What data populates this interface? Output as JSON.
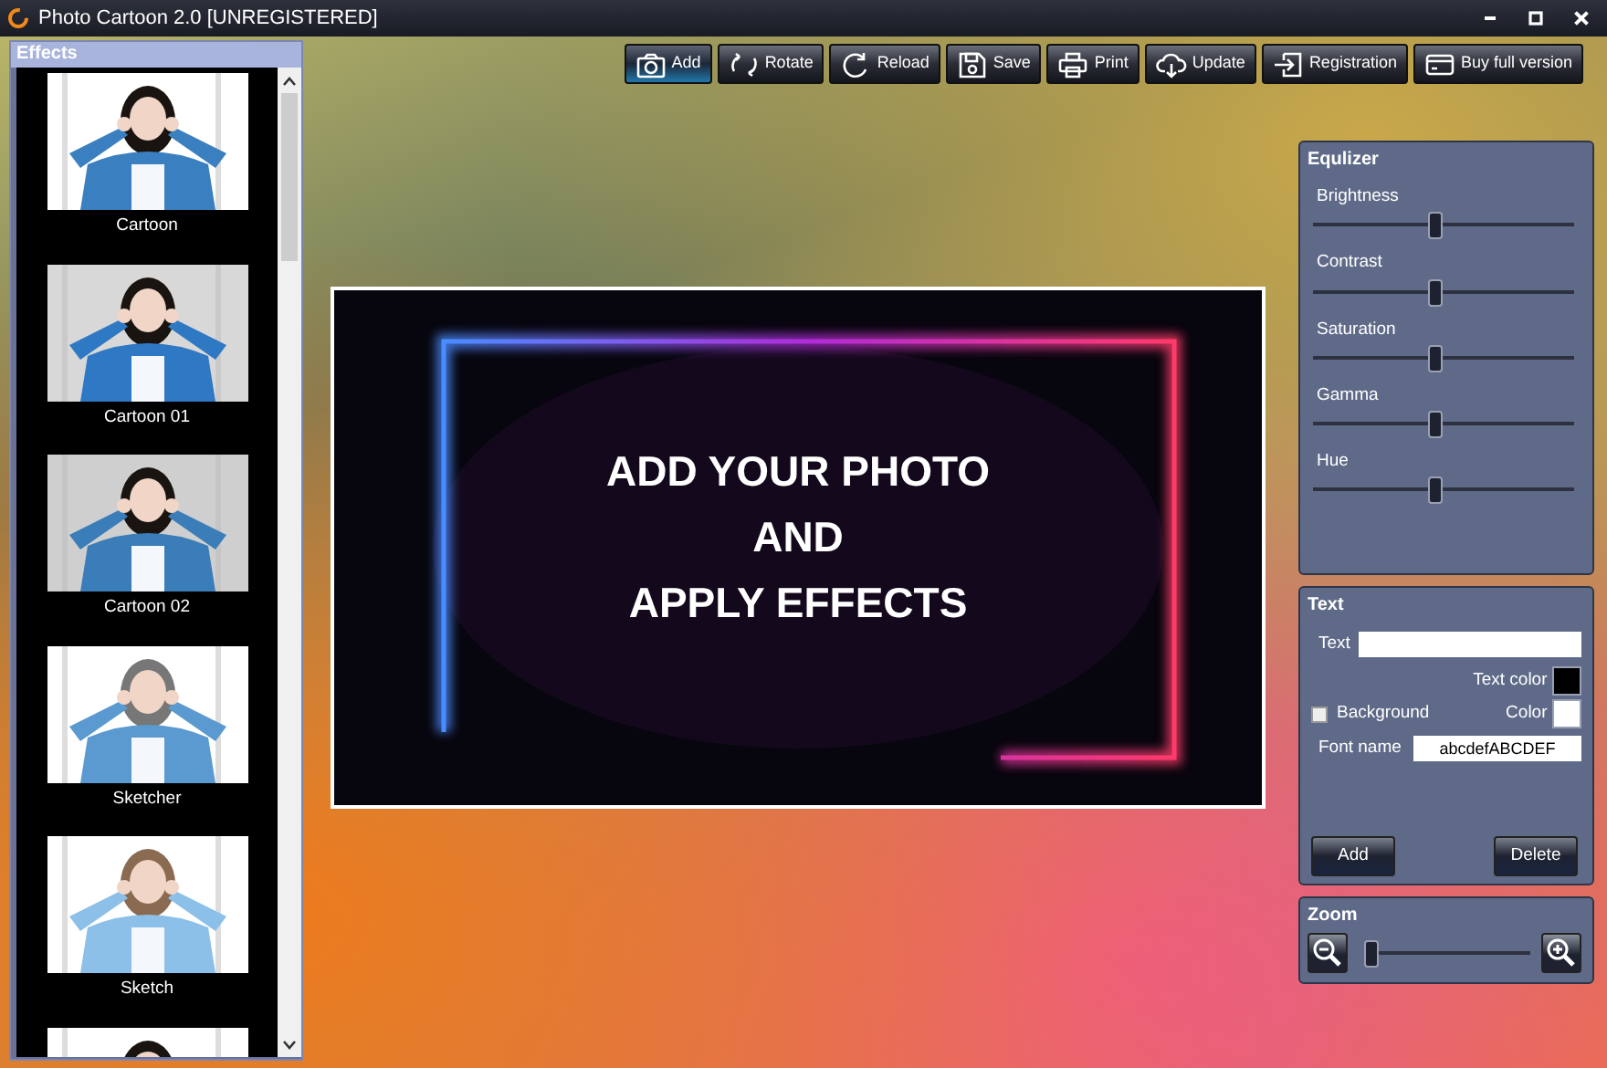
{
  "window": {
    "title": "Photo Cartoon 2.0 [UNREGISTERED]"
  },
  "effects": {
    "title": "Effects",
    "items": [
      {
        "label": "Cartoon"
      },
      {
        "label": "Cartoon 01"
      },
      {
        "label": "Cartoon 02"
      },
      {
        "label": "Sketcher"
      },
      {
        "label": "Sketch"
      }
    ]
  },
  "toolbar": [
    {
      "label": "Add",
      "selected": true
    },
    {
      "label": "Rotate",
      "selected": false
    },
    {
      "label": "Reload",
      "selected": false
    },
    {
      "label": "Save",
      "selected": false
    },
    {
      "label": "Print",
      "selected": false
    },
    {
      "label": "Update",
      "selected": false
    },
    {
      "label": "Registration",
      "selected": false
    },
    {
      "label": "Buy full version",
      "selected": false
    }
  ],
  "preview": {
    "lines": [
      "ADD YOUR PHOTO",
      "AND",
      "APPLY EFFECTS"
    ]
  },
  "equalizer": {
    "title": "Equlizer",
    "sliders": [
      {
        "label": "Brightness",
        "level": 0.47
      },
      {
        "label": "Contrast",
        "level": 0.47
      },
      {
        "label": "Saturation",
        "level": 0.47
      },
      {
        "label": "Gamma",
        "level": 0.47
      },
      {
        "label": "Hue",
        "level": 0.47
      }
    ]
  },
  "text_panel": {
    "title": "Text",
    "text_label": "Text",
    "swatches": [
      {
        "label": "Text color",
        "color": "#000000"
      },
      {
        "label": "Color",
        "color": "#ffffff"
      }
    ],
    "background_label": "Background",
    "background_checked": false,
    "font_label": "Font name",
    "font_value": "abcdefABCDEF",
    "buttons": [
      "Add",
      "Delete"
    ]
  },
  "zoom": {
    "title": "Zoom",
    "level": 0.03
  }
}
